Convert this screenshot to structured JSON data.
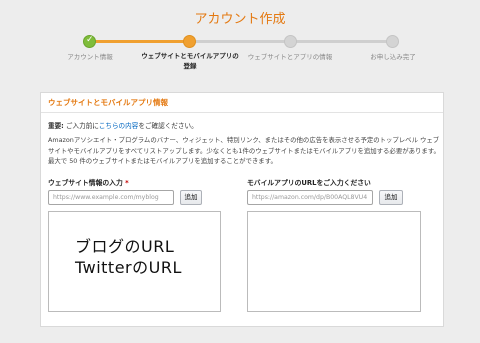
{
  "page": {
    "title": "アカウント作成"
  },
  "stepper": {
    "steps": [
      {
        "label": "アカウント情報",
        "state": "done"
      },
      {
        "label": "ウェブサイトとモバイルアプリの\n登録",
        "state": "current"
      },
      {
        "label": "ウェブサイトとアプリの情報",
        "state": "pending"
      },
      {
        "label": "お申し込み完了",
        "state": "pending"
      }
    ]
  },
  "card": {
    "title": "ウェブサイトとモバイルアプリ情報",
    "notice_bold": "重要:",
    "notice_prefix": " ご入力前に",
    "notice_link": "こちらの内容",
    "notice_suffix": "をご確認ください。",
    "description": "Amazonアソシエイト・プログラムのバナー、ウィジェット、特別リンク、またはその他の広告を表示させる予定のトップレベル ウェブサイトやモバイルアプリをすべてリストアップします。少なくとも1件のウェブサイトまたはモバイルアプリを追加する必要があります。最大で 50 件のウェブサイトまたはモバイルアプリを追加することができます。"
  },
  "website": {
    "label": "ウェブサイト情報の入力",
    "required_mark": "*",
    "placeholder": "https://www.example.com/myblog",
    "add_label": "追加",
    "handwritten_line1": "ブログのURL",
    "handwritten_line2": "TwitterのURL"
  },
  "mobile": {
    "label": "モバイルアプリのURLをご入力ください",
    "placeholder": "https://amazon.com/dp/B00AQL8VU4",
    "add_label": "追加"
  },
  "colors": {
    "accent": "#e47911",
    "done": "#7fbc3a",
    "current": "#f0a030",
    "link": "#0066c0"
  }
}
